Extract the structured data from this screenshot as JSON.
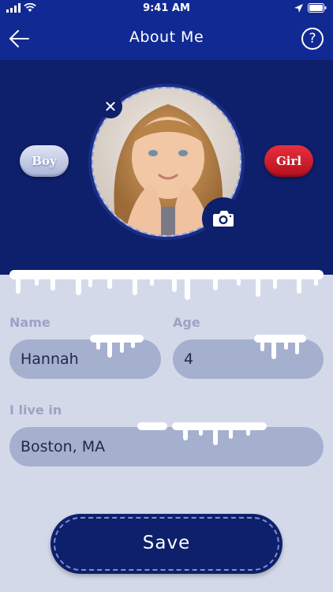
{
  "status_bar": {
    "time": "9:41 AM"
  },
  "nav": {
    "title": "About Me",
    "help": "?"
  },
  "profile": {
    "boy_label": "Boy",
    "girl_label": "Girl",
    "selected_gender": "girl"
  },
  "form": {
    "name_label": "Name",
    "name_value": "Hannah",
    "age_label": "Age",
    "age_value": "4",
    "location_label": "I live in",
    "location_value": "Boston, MA"
  },
  "save_button": {
    "label": "Save"
  },
  "colors": {
    "primary": "#112a93",
    "hero": "#0e1f6b",
    "background": "#d4d9ea",
    "input": "#a5b0cf",
    "girl": "#c8141f"
  }
}
